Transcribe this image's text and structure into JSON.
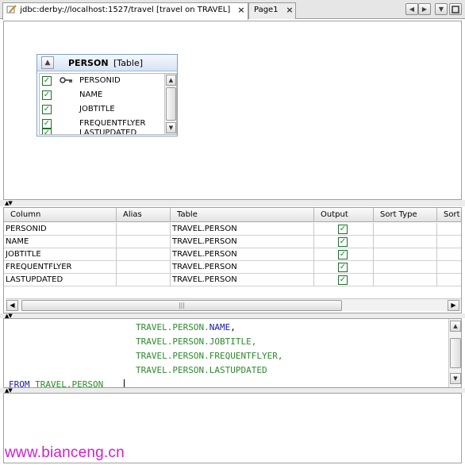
{
  "tabs": [
    {
      "label": "jdbc:derby://localhost:1527/travel [travel on TRAVEL]",
      "active": true,
      "icon": "edit-query-icon"
    },
    {
      "label": "Page1",
      "active": false,
      "icon": ""
    }
  ],
  "tab_nav": {
    "prev_icon": "chevron-left-icon",
    "next_icon": "chevron-right-icon",
    "menu_icon": "dropdown-icon",
    "maximize_icon": "maximize-icon"
  },
  "diagram": {
    "table_name": "PERSON",
    "table_kind": "[Table]",
    "columns": [
      {
        "name": "PERSONID",
        "checked": true,
        "primary_key": true
      },
      {
        "name": "NAME",
        "checked": true,
        "primary_key": false
      },
      {
        "name": "JOBTITLE",
        "checked": true,
        "primary_key": false
      },
      {
        "name": "FREQUENTFLYER",
        "checked": true,
        "primary_key": false
      },
      {
        "name": "LASTUPDATED",
        "checked": true,
        "primary_key": false
      }
    ]
  },
  "grid": {
    "headers": [
      "Column",
      "Alias",
      "Table",
      "Output",
      "Sort Type",
      "Sort"
    ],
    "rows": [
      {
        "column": "PERSONID",
        "alias": "",
        "table": "TRAVEL.PERSON",
        "output": true
      },
      {
        "column": "NAME",
        "alias": "",
        "table": "TRAVEL.PERSON",
        "output": true
      },
      {
        "column": "JOBTITLE",
        "alias": "",
        "table": "TRAVEL.PERSON",
        "output": true
      },
      {
        "column": "FREQUENTFLYER",
        "alias": "",
        "table": "TRAVEL.PERSON",
        "output": true
      },
      {
        "column": "LASTUPDATED",
        "alias": "",
        "table": "TRAVEL.PERSON",
        "output": true
      }
    ]
  },
  "sql": {
    "lines": [
      {
        "prefix": "TRAVEL.PERSON.",
        "field": "NAME",
        "suffix": ","
      },
      {
        "prefix": "TRAVEL.PERSON.",
        "field": "JOBTITLE",
        "suffix": ","
      },
      {
        "prefix": "TRAVEL.PERSON.",
        "field": "FREQUENTFLYER",
        "suffix": ","
      },
      {
        "prefix": "TRAVEL.PERSON.",
        "field": "LASTUPDATED",
        "suffix": ""
      }
    ],
    "from_keyword": "FROM",
    "from_table": "TRAVEL.PERSON"
  },
  "watermark": "www.bianceng.cn",
  "colors": {
    "sql_green": "#2d8a2d",
    "sql_blue": "#1a1aa6",
    "watermark": "#d41cd4",
    "check_green": "#1a8a2a"
  }
}
